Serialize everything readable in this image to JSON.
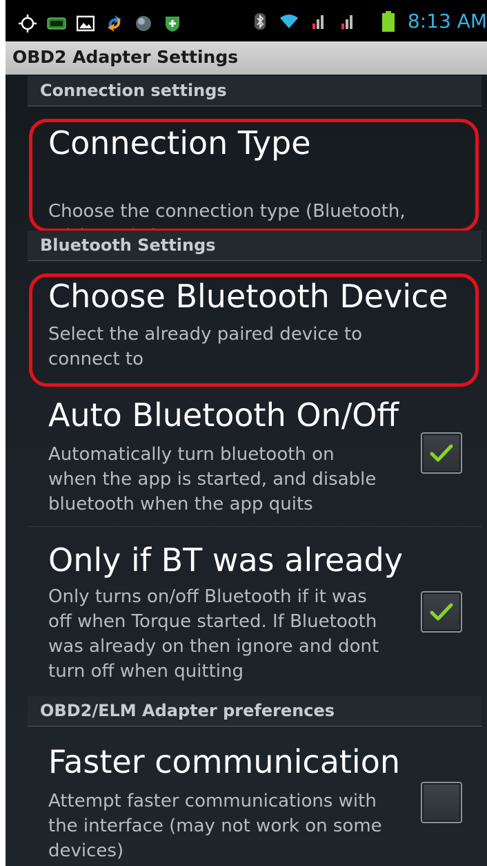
{
  "status_bar": {
    "time": "8:13 AM",
    "left_icons": [
      "gps-icon",
      "obd-icon",
      "gallery-icon",
      "sync-icon",
      "globe-icon",
      "shield-icon"
    ],
    "right_icons": [
      "bluetooth-icon",
      "wifi-icon",
      "signal-icon",
      "signal-icon",
      "battery-icon"
    ]
  },
  "window_title": "OBD2 Adapter Settings",
  "sections": {
    "connection": "Connection settings",
    "bluetooth": "Bluetooth Settings",
    "adapter": "OBD2/ELM Adapter preferences"
  },
  "prefs": {
    "connection_type": {
      "title": "Connection Type",
      "summary_1": "Choose the connection type (Bluetooth,",
      "summary_2": "WiFi or USB)"
    },
    "choose_device": {
      "title": "Choose Bluetooth Device",
      "summary_1": "Select the already paired device to",
      "summary_2": "connect to"
    },
    "auto_bt": {
      "title": "Auto Bluetooth On/Off",
      "summary_1": "Automatically turn bluetooth on",
      "summary_2": "when the app is started, and disable",
      "summary_3": "bluetooth when the app quits",
      "checked": true
    },
    "only_if_bt": {
      "title": "Only if BT was already",
      "summary_1": "Only turns on/off Bluetooth if it was",
      "summary_2": "off when Torque started. If Bluetooth",
      "summary_3": "was already on then ignore and dont",
      "summary_4": "turn off when quitting",
      "checked": true
    },
    "faster_comm": {
      "title": "Faster communication",
      "summary_1": "Attempt faster communications with",
      "summary_2": "the interface (may not work on some",
      "summary_3": "devices)",
      "checked": false
    }
  },
  "colors": {
    "highlight": "#e3101c",
    "accent": "#33b5e5",
    "check": "#8bd12a"
  }
}
